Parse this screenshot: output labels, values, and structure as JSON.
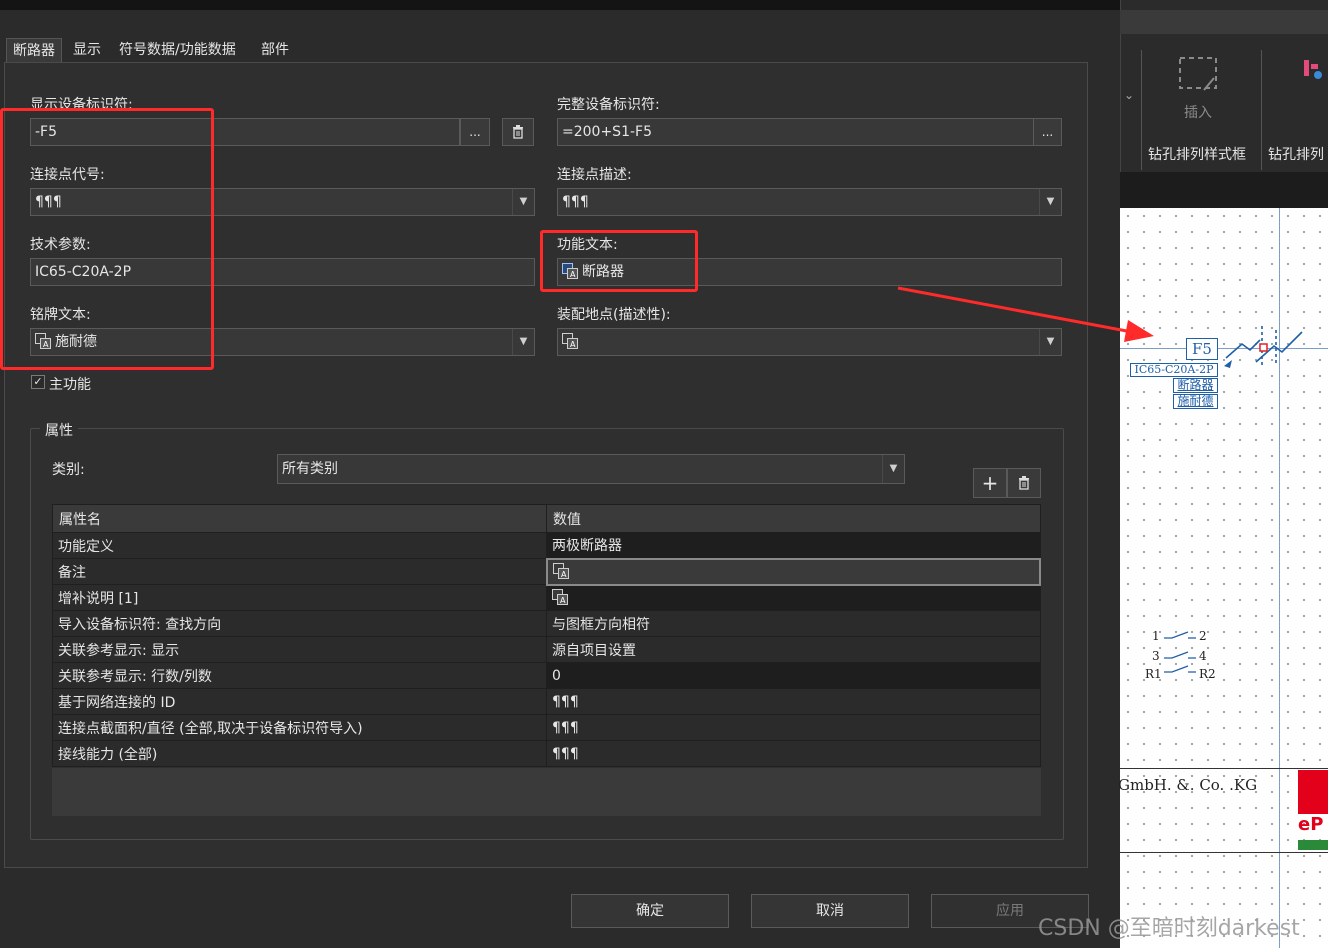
{
  "tabs": [
    "断路器",
    "显示",
    "符号数据/功能数据",
    "部件"
  ],
  "fields": {
    "display_dt_label": "显示设备标识符:",
    "display_dt_value": "-F5",
    "full_dt_label": "完整设备标识符:",
    "full_dt_value": "=200+S1-F5",
    "conn_code_label": "连接点代号:",
    "conn_code_value": "¶¶¶",
    "conn_desc_label": "连接点描述:",
    "conn_desc_value": "¶¶¶",
    "tech_label": "技术参数:",
    "tech_value": "IC65-C20A-2P",
    "func_text_label": "功能文本:",
    "func_text_value": "断路器",
    "nameplate_label": "铭牌文本:",
    "nameplate_value": "施耐德",
    "mount_label": "装配地点(描述性):",
    "mount_value": "",
    "main_function_label": "主功能",
    "ellipsis": "..."
  },
  "properties": {
    "group_title": "属性",
    "category_label": "类别:",
    "category_value": "所有类别",
    "add": "+",
    "header_name": "属性名",
    "header_value": "数值",
    "rows": [
      {
        "name": "功能定义",
        "value": "两极断路器"
      },
      {
        "name": "备注",
        "value": ""
      },
      {
        "name": "增补说明 [1]",
        "value": ""
      },
      {
        "name": "导入设备标识符: 查找方向",
        "value": "与图框方向相符"
      },
      {
        "name": "关联参考显示: 显示",
        "value": "源自项目设置"
      },
      {
        "name": "关联参考显示: 行数/列数",
        "value": "0"
      },
      {
        "name": "基于网络连接的 ID",
        "value": "¶¶¶"
      },
      {
        "name": "连接点截面积/直径 (全部,取决于设备标识符导入)",
        "value": "¶¶¶"
      },
      {
        "name": "接线能力 (全部)",
        "value": "¶¶¶"
      }
    ]
  },
  "footer": {
    "ok": "确定",
    "cancel": "取消",
    "apply": "应用"
  },
  "ribbon": {
    "insert": "插入",
    "drill1": "钻孔排列样式框",
    "drill2": "钻孔排列"
  },
  "schematic": {
    "tag": "F5",
    "tech": "IC65-C20A-2P",
    "func": "断路器",
    "plate": "施耐德",
    "pin1": "1",
    "pin2": "2",
    "pin3": "3",
    "pin4": "4",
    "pinR1": "R1",
    "pinR2": "R2",
    "company": "GmbH. &. Co. .KG",
    "logo": "eP"
  },
  "watermark": "CSDN @至暗时刻darkest",
  "colors": {
    "highlight": "#ff2a2a",
    "schematic_blue": "#1f5fa8"
  }
}
